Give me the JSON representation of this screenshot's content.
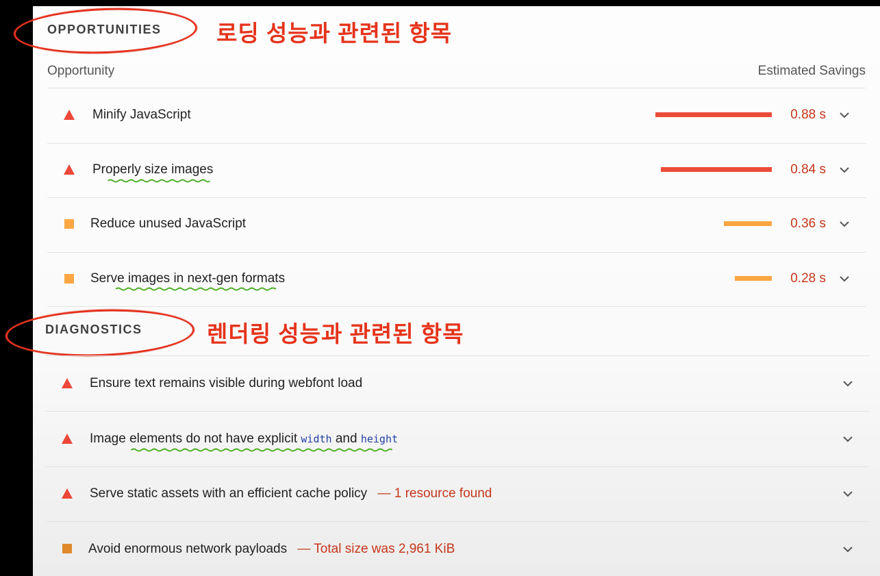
{
  "opportunities": {
    "section_label": "OPPORTUNITIES",
    "annotation": "로딩 성능과 관련된 항목",
    "column_opportunity": "Opportunity",
    "column_savings": "Estimated Savings",
    "items": [
      {
        "title": "Minify JavaScript",
        "saving": "0.88 s",
        "severity": "fail",
        "bar_fraction": 1.0
      },
      {
        "title": "Properly size images",
        "saving": "0.84 s",
        "severity": "fail",
        "bar_fraction": 0.955
      },
      {
        "title": "Reduce unused JavaScript",
        "saving": "0.36 s",
        "severity": "average",
        "bar_fraction": 0.41
      },
      {
        "title": "Serve images in next-gen formats",
        "saving": "0.28 s",
        "severity": "average",
        "bar_fraction": 0.32
      }
    ]
  },
  "diagnostics": {
    "section_label": "DIAGNOSTICS",
    "annotation": "렌더링 성능과 관련된 항목",
    "items": [
      {
        "title": "Ensure text remains visible during webfont load",
        "severity": "fail"
      },
      {
        "title_prefix": "Image elements do not have explicit ",
        "code1": "width",
        "middle": " and ",
        "code2": "height",
        "severity": "fail"
      },
      {
        "title": "Serve static assets with an efficient cache policy",
        "detail": "— 1 resource found",
        "severity": "fail"
      },
      {
        "title": "Avoid enormous network payloads",
        "detail": "— Total size was 2,961 KiB",
        "severity": "average"
      }
    ]
  },
  "colors": {
    "fail": "#eb4c3a",
    "average": "#fba641",
    "annotation_red": "#e5331b",
    "underline_green": "#4caf25",
    "savings_text": "#c5361c"
  },
  "icons": {
    "fail": "red-triangle-icon",
    "average": "orange-square-icon",
    "expand": "chevron-down-icon"
  }
}
